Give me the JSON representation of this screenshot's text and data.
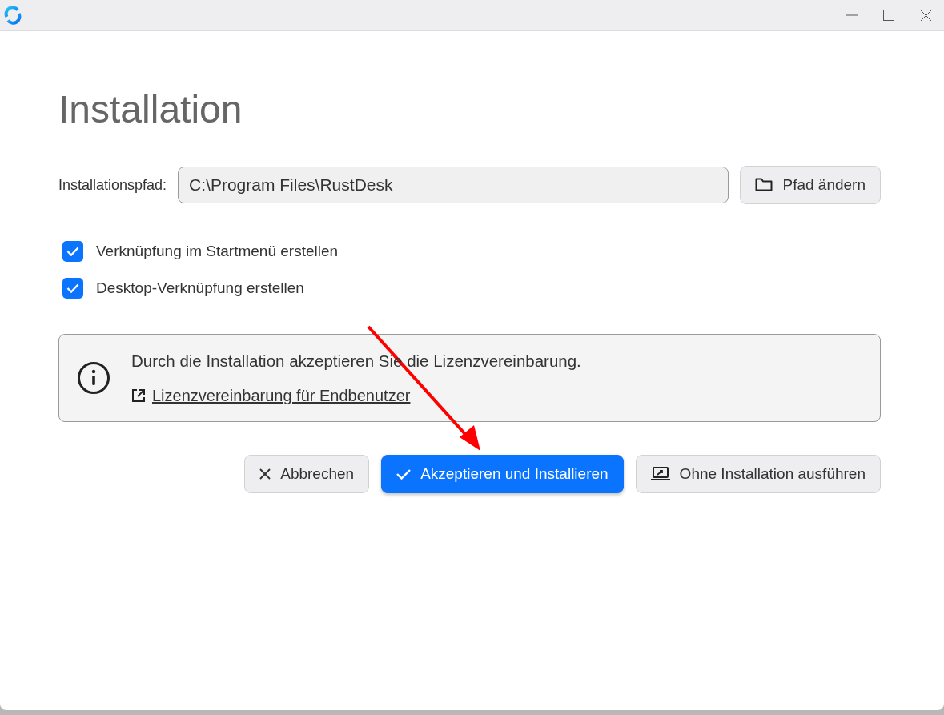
{
  "window": {
    "controls": [
      {
        "kind": "minimize"
      },
      {
        "kind": "maximize"
      },
      {
        "kind": "close"
      }
    ]
  },
  "title": "Installation",
  "path": {
    "label": "Installationspfad:",
    "value": "C:\\Program Files\\RustDesk",
    "button": "Pfad ändern"
  },
  "options": [
    {
      "label": "Verknüpfung im Startmenü erstellen",
      "checked": true
    },
    {
      "label": "Desktop-Verknüpfung erstellen",
      "checked": true
    }
  ],
  "notice": {
    "text": "Durch die Installation akzeptieren Sie die Lizenzvereinbarung.",
    "link": "Lizenzvereinbarung für Endbenutzer"
  },
  "buttons": [
    {
      "kind": "cancel",
      "label": "Abbrechen"
    },
    {
      "kind": "accept",
      "label": "Akzeptieren und Installieren"
    },
    {
      "kind": "run",
      "label": "Ohne Installation ausführen"
    }
  ]
}
